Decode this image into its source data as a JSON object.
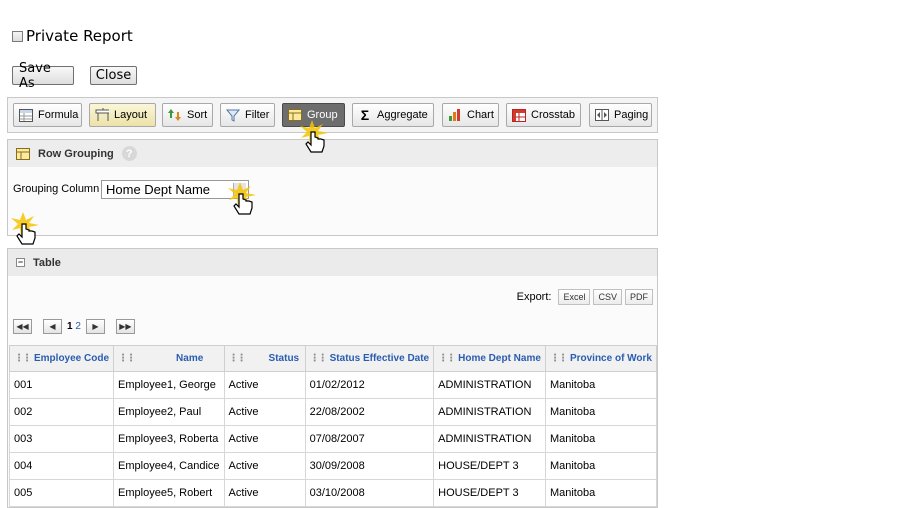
{
  "private_report": {
    "label": "Private Report",
    "checked": false
  },
  "actions": {
    "save_as": "Save As",
    "close": "Close"
  },
  "toolbar": [
    {
      "label": "Formula",
      "icon": "formula-icon",
      "state": "normal"
    },
    {
      "label": "Layout",
      "icon": "layout-icon",
      "state": "highlighted"
    },
    {
      "label": "Sort",
      "icon": "sort-icon",
      "state": "normal"
    },
    {
      "label": "Filter",
      "icon": "filter-icon",
      "state": "normal"
    },
    {
      "label": "Group",
      "icon": "group-icon",
      "state": "active"
    },
    {
      "label": "Aggregate",
      "icon": "sigma-icon",
      "state": "normal"
    },
    {
      "label": "Chart",
      "icon": "bar-chart-icon",
      "state": "normal"
    },
    {
      "label": "Crosstab",
      "icon": "crosstab-icon",
      "state": "normal"
    },
    {
      "label": "Paging",
      "icon": "paging-icon",
      "state": "normal"
    }
  ],
  "row_grouping": {
    "title": "Row Grouping",
    "help": "?",
    "column_label": "Grouping Column",
    "selected_value": "Home Dept Name"
  },
  "table_panel": {
    "title": "Table",
    "export_label": "Export:",
    "export_buttons": [
      "Excel",
      "CSV",
      "PDF"
    ],
    "pager": {
      "current": "1",
      "other": "2"
    },
    "columns": [
      "Employee Code",
      "Name",
      "Status",
      "Status Effective Date",
      "Home Dept Name",
      "Province of Work"
    ],
    "rows": [
      [
        "001",
        "Employee1, George",
        "Active",
        "01/02/2012",
        "ADMINISTRATION",
        "Manitoba"
      ],
      [
        "002",
        "Employee2, Paul",
        "Active",
        "22/08/2002",
        "ADMINISTRATION",
        "Manitoba"
      ],
      [
        "003",
        "Employee3, Roberta",
        "Active",
        "07/08/2007",
        "ADMINISTRATION",
        "Manitoba"
      ],
      [
        "004",
        "Employee4, Candice",
        "Active",
        "30/09/2008",
        "HOUSE/DEPT 3",
        "Manitoba"
      ],
      [
        "005",
        "Employee5, Robert",
        "Active",
        "03/10/2008",
        "HOUSE/DEPT 3",
        "Manitoba"
      ]
    ]
  },
  "colors": {
    "link_blue": "#2a5db0",
    "active_button": "#6d6d6d",
    "cursor_glow": "#f5c400"
  }
}
